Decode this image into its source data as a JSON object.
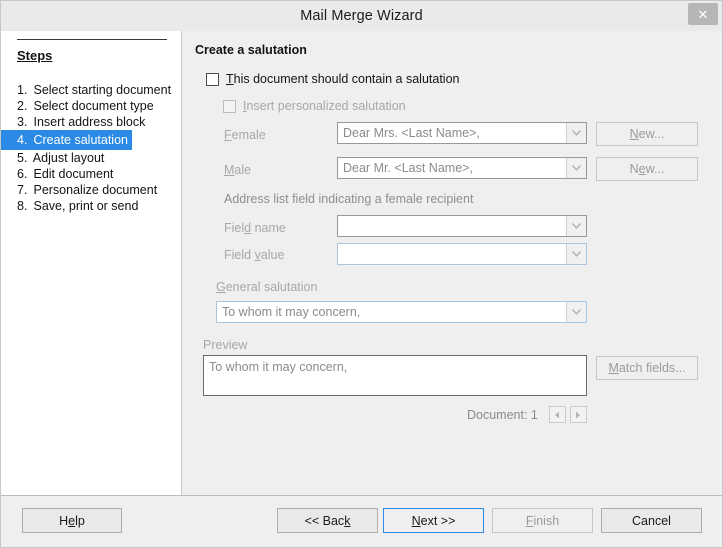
{
  "window": {
    "title": "Mail Merge Wizard",
    "close_icon": "close-icon",
    "close_glyph": "✕"
  },
  "sidebar": {
    "heading": "Steps",
    "items": [
      {
        "num": "1.",
        "label": "Select starting document",
        "active": false
      },
      {
        "num": "2.",
        "label": "Select document type",
        "active": false
      },
      {
        "num": "3.",
        "label": "Insert address block",
        "active": false
      },
      {
        "num": "4.",
        "label": "Create salutation",
        "active": true
      },
      {
        "num": "5.",
        "label": "Adjust layout",
        "active": false
      },
      {
        "num": "6.",
        "label": "Edit document",
        "active": false
      },
      {
        "num": "7.",
        "label": "Personalize document",
        "active": false
      },
      {
        "num": "8.",
        "label": "Save, print or send",
        "active": false
      }
    ]
  },
  "panel": {
    "title": "Create a salutation",
    "contain_salutation": {
      "label_pre": "",
      "label_accel": "T",
      "label_post": "his document should contain a salutation",
      "checked": false,
      "enabled": true
    },
    "personalized_salutation": {
      "label_pre": "",
      "label_accel": "I",
      "label_post": "nsert personalized salutation",
      "checked": false,
      "enabled": false
    },
    "female": {
      "label_pre": "",
      "label_accel": "F",
      "label_post": "emale",
      "value": "Dear Mrs. <Last Name>,",
      "new_button": {
        "pre": "",
        "accel": "N",
        "post": "ew..."
      }
    },
    "male": {
      "label_pre": "",
      "label_accel": "M",
      "label_post": "ale",
      "value": "Dear Mr. <Last Name>,",
      "new_button": {
        "pre": "N",
        "accel": "e",
        "post": "w..."
      }
    },
    "address_list_section": "Address list field indicating a female recipient",
    "field_name": {
      "label_pre": "Fiel",
      "label_accel": "d",
      "label_post": " name",
      "value": ""
    },
    "field_value": {
      "label_pre": "Field ",
      "label_accel": "v",
      "label_post": "alue",
      "value": ""
    },
    "general_salutation": {
      "label_pre": "",
      "label_accel": "G",
      "label_post": "eneral salutation",
      "value": "To whom it may concern,"
    },
    "preview": {
      "label": "Preview",
      "text": "To whom it may concern,"
    },
    "match_fields": {
      "pre": "",
      "accel": "M",
      "post": "atch fields..."
    },
    "document_nav": {
      "label": "Document: 1",
      "prev_icon": "triangle-left-icon",
      "next_icon": "triangle-right-icon"
    }
  },
  "footer": {
    "help": {
      "pre": "H",
      "accel": "e",
      "post": "lp",
      "enabled": true
    },
    "back": {
      "pre": "<< Bac",
      "accel": "k",
      "post": "",
      "enabled": true
    },
    "next": {
      "pre": "",
      "accel": "N",
      "post": "ext >>",
      "enabled": true,
      "focused": true
    },
    "finish": {
      "pre": "",
      "accel": "F",
      "post": "inish",
      "enabled": false
    },
    "cancel": {
      "pre": "Cancel",
      "accel": "",
      "post": "",
      "enabled": true
    }
  },
  "colors": {
    "accent": "#2a8ae5",
    "window_bg": "#efefef",
    "sidebar_bg": "#ffffff",
    "disabled_text": "#a8a8a8"
  }
}
